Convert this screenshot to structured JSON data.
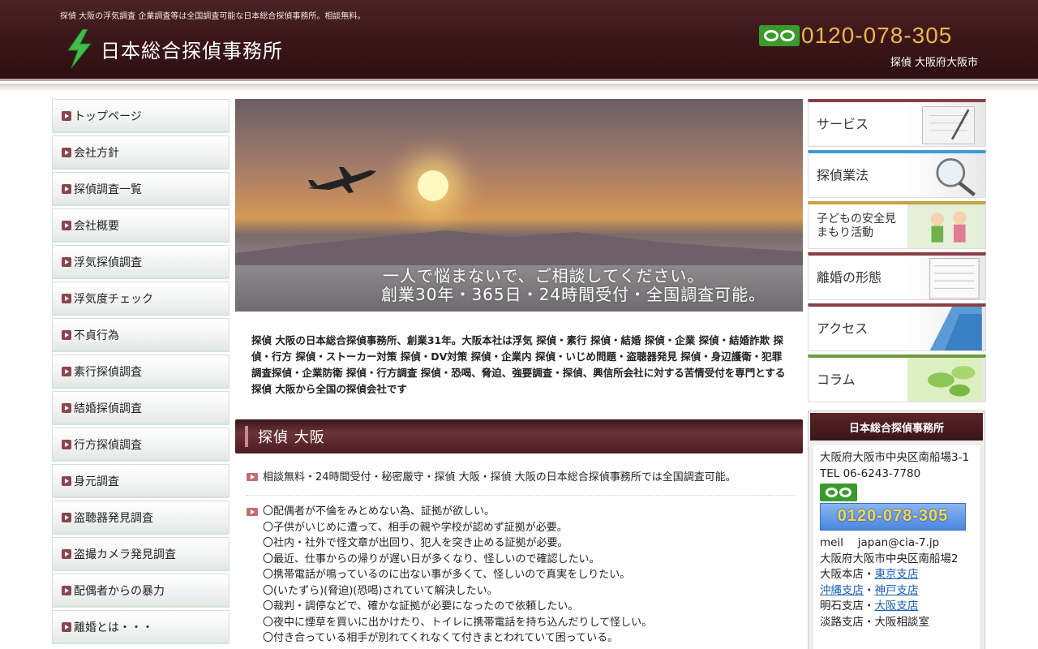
{
  "header": {
    "tagline": "探偵 大阪の浮気調査 企業調査等は全国調査可能な日本総合探偵事務所。相談無料。",
    "logo_text": "日本総合探偵事務所",
    "phone": "0120-078-305",
    "region": "探偵 大阪府大阪市"
  },
  "nav": {
    "items": [
      {
        "label": "トップページ"
      },
      {
        "label": "会社方針"
      },
      {
        "label": "探偵調査一覧"
      },
      {
        "label": "会社概要"
      },
      {
        "label": "浮気探偵調査"
      },
      {
        "label": "浮気度チェック"
      },
      {
        "label": "不貞行為"
      },
      {
        "label": "素行探偵調査"
      },
      {
        "label": "結婚探偵調査"
      },
      {
        "label": "行方探偵調査"
      },
      {
        "label": "身元調査"
      },
      {
        "label": "盗聴器発見調査"
      },
      {
        "label": "盗撮カメラ発見調査"
      },
      {
        "label": "配偶者からの暴力"
      },
      {
        "label": "離婚とは・・・"
      }
    ]
  },
  "hero": {
    "line1": "一人で悩まないで、ご相談してください。",
    "line2": "創業30年・365日・24時間受付・全国調査可能。"
  },
  "intro": "探偵 大阪の日本総合探偵事務所、創業31年。大阪本社は浮気 探偵・素行 探偵・結婚 探偵・企業 探偵・結婚詐欺 探偵・行方 探偵・ストーカー対策 探偵・DV対策 探偵・企業内 探偵・いじめ問題・盗聴器発見 探偵・身辺護衛・犯罪調査探偵・企業防衛 探偵・行方調査 探偵・恐喝、脅迫、強要調査・探偵、興信所会社に対する苦情受付を専門とする探偵 大阪から全国の探偵会社です",
  "section": {
    "title": "探偵 大阪",
    "lead": "相談無料・24時間受付・秘密厳守・探偵 大阪・探偵 大阪の日本総合探偵事務所では全国調査可能。",
    "items": [
      "〇配偶者が不倫をみとめない為、証拠が欲しい。",
      "〇子供がいじめに遭って、相手の親や学校が認めず証拠が必要。",
      "〇社内・社外で怪文章が出回り、犯人を突き止める証拠が必要。",
      "〇最近、仕事からの帰りが遅い日が多くなり、怪しいので確認したい。",
      "〇携帯電話が鳴っているのに出ない事が多くて、怪しいので真実をしりたい。",
      "〇(いたずら)(脅迫)(恐喝)されていて解決したい。",
      "〇裁判・調停などで、確かな証拠が必要になったので依頼したい。",
      "〇夜中に煙草を買いに出かけたり、トイレに携帯電話を持ち込んだりして怪しい。",
      "〇付き合っている相手が別れてくれなくて付きまとわれていて困っている。"
    ]
  },
  "right_banners": [
    {
      "label": "サービス",
      "accent": "#8a3e44"
    },
    {
      "label": "探偵業法",
      "accent": "#3e9bd6"
    },
    {
      "label": "子どもの安全見まもり活動",
      "accent": "#c9a23c"
    },
    {
      "label": "離婚の形態",
      "accent": "#8a3e44"
    },
    {
      "label": "アクセス",
      "accent": "#8a3e44"
    },
    {
      "label": "コラム",
      "accent": "#6b9c3b"
    }
  ],
  "info": {
    "title": "日本総合探偵事務所",
    "address": "大阪府大阪市中央区南船場3-1",
    "tel": "TEL 06-6243-7780",
    "phone": "0120-078-305",
    "mail": "meil　 japan@cia-7.jp",
    "address2": "大阪府大阪市中央区南船場2",
    "line_osaka_head": "大阪本店・",
    "link_tokyo": "東京支店",
    "link_okinawa": "沖縄支店",
    "sep1": "・",
    "link_kobe": "神戸支店",
    "akashi": "明石支店・",
    "link_osaka": "大阪支店",
    "awaji": "淡路支店・大阪相談室"
  },
  "colors": {
    "header_bg": "#3a1518",
    "accent": "#8a3e44",
    "phone": "#e8b84d",
    "link": "#1a5fb4"
  }
}
